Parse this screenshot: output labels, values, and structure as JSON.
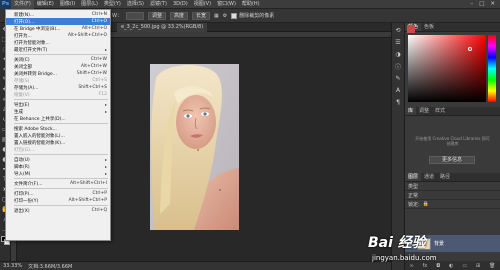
{
  "app": {
    "logo": "Ps"
  },
  "menubar": {
    "items": [
      "文件(F)",
      "编辑(E)",
      "图像(I)",
      "图层(L)",
      "类型(Y)",
      "选择(S)",
      "滤镜(T)",
      "3D(D)",
      "视图(V)",
      "窗口(W)",
      "帮助(H)"
    ],
    "active_index": 0
  },
  "options_bar": {
    "transform_label": "调整",
    "ctrl_label": "W：",
    "btn1": "高度",
    "btn2": "长宽",
    "chk_label": "删除裁剪的像素"
  },
  "document": {
    "tab_title": "e_3_2c_500.jpg @ 33.2%(RGB/8)"
  },
  "status": {
    "zoom": "33.33%",
    "doc": "文档:3.66M/3.66M"
  },
  "panels": {
    "color_tab": "颜色",
    "swatch_tab": "色板",
    "lib_tab1": "库",
    "lib_tab2": "调整",
    "lib_tab3": "样式",
    "lib_message": "开始使用 Creative Cloud Libraries 即可创建库",
    "lib_button": "更多信息",
    "layers_tab": "图层",
    "channels_tab": "通道",
    "paths_tab": "路径",
    "kind_label": "类型",
    "blend_label": "正常",
    "lock_label": "锁定:",
    "layer_name": "背景",
    "fg_color": "#c94a4a"
  },
  "file_menu": {
    "items": [
      {
        "label": "新建(N)...",
        "shortcut": "Ctrl+N",
        "state": "normal"
      },
      {
        "label": "打开(O)...",
        "shortcut": "Ctrl+O",
        "state": "highlight"
      },
      {
        "label": "在 Bridge 中浏览(B)...",
        "shortcut": "Alt+Ctrl+O",
        "state": "normal"
      },
      {
        "label": "打开为...",
        "shortcut": "Alt+Shift+Ctrl+O",
        "state": "normal"
      },
      {
        "label": "打开为智能对象...",
        "shortcut": "",
        "state": "normal"
      },
      {
        "label": "最近打开文件(T)",
        "shortcut": "▸",
        "state": "normal"
      },
      {
        "sep": true
      },
      {
        "label": "关闭(C)",
        "shortcut": "Ctrl+W",
        "state": "normal"
      },
      {
        "label": "关闭全部",
        "shortcut": "Alt+Ctrl+W",
        "state": "normal"
      },
      {
        "label": "关闭并转到 Bridge...",
        "shortcut": "Shift+Ctrl+W",
        "state": "normal"
      },
      {
        "label": "存储(S)",
        "shortcut": "Ctrl+S",
        "state": "disabled"
      },
      {
        "label": "存储为(A)...",
        "shortcut": "Shift+Ctrl+S",
        "state": "normal"
      },
      {
        "label": "恢复(V)",
        "shortcut": "F12",
        "state": "disabled"
      },
      {
        "sep": true
      },
      {
        "label": "导出(E)",
        "shortcut": "▸",
        "state": "normal"
      },
      {
        "label": "生成",
        "shortcut": "▸",
        "state": "normal"
      },
      {
        "label": "在 Behance 上共享(D)...",
        "shortcut": "",
        "state": "normal"
      },
      {
        "sep": true
      },
      {
        "label": "搜索 Adobe Stock...",
        "shortcut": "",
        "state": "normal"
      },
      {
        "label": "置入嵌入的智能对象(L)...",
        "shortcut": "",
        "state": "normal"
      },
      {
        "label": "置入链接的智能对象(K)...",
        "shortcut": "",
        "state": "normal"
      },
      {
        "label": "打包(G)...",
        "shortcut": "",
        "state": "disabled"
      },
      {
        "sep": true
      },
      {
        "label": "自动(U)",
        "shortcut": "▸",
        "state": "normal"
      },
      {
        "label": "脚本(R)",
        "shortcut": "▸",
        "state": "normal"
      },
      {
        "label": "导入(M)",
        "shortcut": "▸",
        "state": "normal"
      },
      {
        "sep": true
      },
      {
        "label": "文件简介(F)...",
        "shortcut": "Alt+Shift+Ctrl+I",
        "state": "normal"
      },
      {
        "sep": true
      },
      {
        "label": "打印(P)...",
        "shortcut": "Ctrl+P",
        "state": "normal"
      },
      {
        "label": "打印一份(Y)",
        "shortcut": "Alt+Shift+Ctrl+P",
        "state": "normal"
      },
      {
        "sep": true
      },
      {
        "label": "退出(X)",
        "shortcut": "Ctrl+Q",
        "state": "normal"
      }
    ]
  },
  "watermark": {
    "main": "Bai 经验",
    "sub": "jingyan.baidu.com"
  }
}
